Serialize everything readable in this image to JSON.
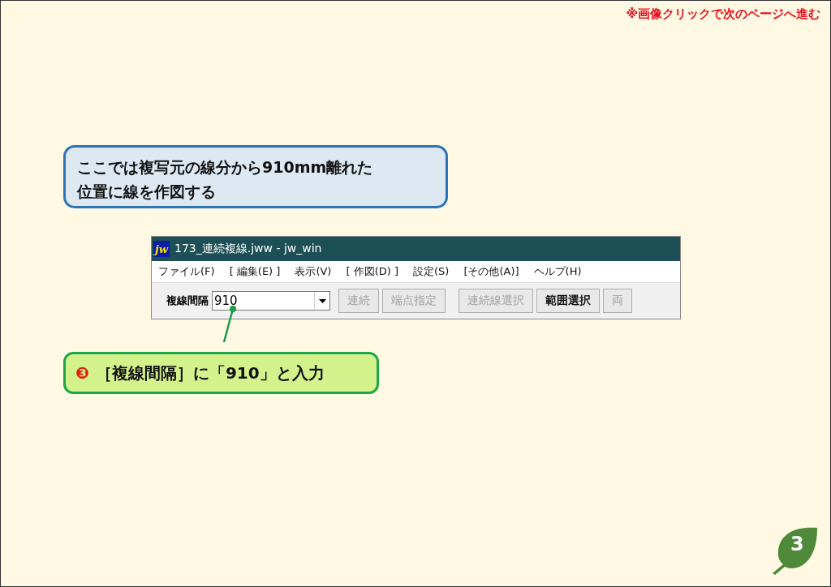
{
  "note": "※画像クリックで次のページへ進む",
  "explanation": "ここでは複写元の線分から910mm離れた位置に線を作図する",
  "window": {
    "logo": "jw",
    "title": "173_連続複線.jww - jw_win",
    "menus": [
      "ファイル(F)",
      "[ 編集(E) ]",
      "表示(V)",
      "[ 作図(D) ]",
      "設定(S)",
      "[その他(A)]",
      "ヘルプ(H)"
    ],
    "field_label": "複線間隔",
    "field_value": "910",
    "button_groups": [
      [
        {
          "label": "連続",
          "disabled": true
        },
        {
          "label": "端点指定",
          "disabled": true
        }
      ],
      [
        {
          "label": "連続線選択",
          "disabled": true
        },
        {
          "label": "範囲選択",
          "disabled": false
        },
        {
          "label": "両",
          "disabled": true
        }
      ]
    ]
  },
  "step": {
    "number": "❸",
    "text": "［複線間隔］に「910」と入力"
  },
  "page_number": "3"
}
